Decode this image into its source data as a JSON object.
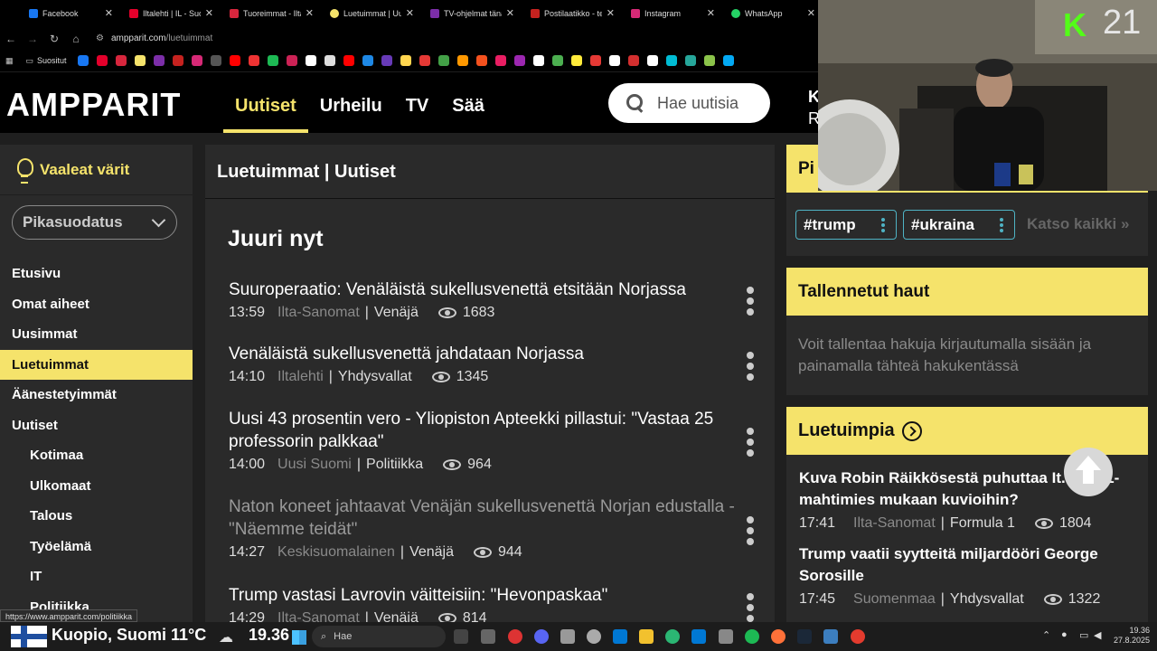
{
  "browser": {
    "tabs": [
      {
        "label": "Facebook",
        "color": "#1877f2"
      },
      {
        "label": "Iltalehti | IL - Suo",
        "color": "#e4002b"
      },
      {
        "label": "Tuoreimmat - Ilta",
        "color": "#d7263d"
      },
      {
        "label": "Luetuimmat | Uut",
        "color": "#f5e36b"
      },
      {
        "label": "TV-ohjelmat tänä",
        "color": "#7c2ea8"
      },
      {
        "label": "Postilaatikko - tee",
        "color": "#444"
      },
      {
        "label": "Instagram",
        "color": "#d62976"
      },
      {
        "label": "WhatsApp",
        "color": "#25d366"
      }
    ],
    "url_host": "ampparit.com",
    "url_path": "/luetuimmat",
    "bookmarks_label": "Suositut"
  },
  "header": {
    "logo": "AMPPARIT",
    "nav": [
      {
        "label": "Uutiset",
        "active": true
      },
      {
        "label": "Urheilu",
        "active": false
      },
      {
        "label": "TV",
        "active": false
      },
      {
        "label": "Sää",
        "active": false
      }
    ],
    "search_placeholder": "Hae uutisia",
    "cut_text_1": "K",
    "cut_text_2": "R"
  },
  "sidebar": {
    "theme_toggle": "Vaaleat värit",
    "quick_filter": "Pikasuodatus",
    "items": [
      {
        "label": "Etusivu"
      },
      {
        "label": "Omat aiheet"
      },
      {
        "label": "Uusimmat"
      },
      {
        "label": "Luetuimmat"
      },
      {
        "label": "Äänestetyimmät"
      },
      {
        "label": "Uutiset"
      },
      {
        "label": "Kotimaa"
      },
      {
        "label": "Ulkomaat"
      },
      {
        "label": "Talous"
      },
      {
        "label": "Työelämä"
      },
      {
        "label": "IT"
      },
      {
        "label": "Politiikka"
      }
    ]
  },
  "main": {
    "title": "Luetuimmat | Uutiset",
    "section": "Juuri nyt",
    "articles": [
      {
        "title": "Suuroperaatio: Venäläistä sukellusvenettä etsitään Norjassa",
        "time": "13:59",
        "source": "Ilta-Sanomat",
        "category": "Venäjä",
        "views": "1683",
        "read": false
      },
      {
        "title": "Venäläistä sukellusvenettä jahdataan Norjassa",
        "time": "14:10",
        "source": "Iltalehti",
        "category": "Yhdysvallat",
        "views": "1345",
        "read": false
      },
      {
        "title": "Uusi 43 prosentin vero - Yliopiston Apteekki pillastui: \"Vastaa 25 professorin palkkaa\"",
        "time": "14:00",
        "source": "Uusi Suomi",
        "category": "Politiikka",
        "views": "964",
        "read": false
      },
      {
        "title": "Naton koneet jahtaavat Venäjän sukellusvenettä Norjan edustalla - \"Näemme teidät\"",
        "time": "14:27",
        "source": "Keskisuomalainen",
        "category": "Venäjä",
        "views": "944",
        "read": true
      },
      {
        "title": "Trump vastasi Lavrovin väitteisiin: \"Hevonpaskaa\"",
        "time": "14:29",
        "source": "Ilta-Sanomat",
        "category": "Venäjä",
        "views": "814",
        "read": false
      }
    ]
  },
  "right": {
    "trending_title_cut": "Pi",
    "tags": [
      "#trump",
      "#ukraina"
    ],
    "see_all": "Katso kaikki »",
    "saved_title": "Tallennetut haut",
    "saved_text": "Voit tallentaa hakuja kirjautumalla sisään ja painamalla tähteä hakukentässä",
    "popular_title": "Luetuimpia",
    "popular": [
      {
        "title": "Kuva Robin Räikkösestä puhuttaa It...a - F1-mahtimies mukaan kuvioihin?",
        "time": "17:41",
        "source": "Ilta-Sanomat",
        "category": "Formula 1",
        "views": "1804"
      },
      {
        "title": "Trump vaatii syytteitä miljardööri George Sorosille",
        "time": "17:45",
        "source": "Suomenmaa",
        "category": "Yhdysvallat",
        "views": "1322"
      }
    ]
  },
  "overlay": {
    "viewer_count": "21",
    "brand_letter": "K"
  },
  "status_url": "https://www.ampparit.com/politiikka",
  "taskbar": {
    "weather": "Kuopio, Suomi 11°C",
    "temp": "19.36",
    "search": "Hae",
    "time": "19.36",
    "date": "27.8.2025"
  }
}
